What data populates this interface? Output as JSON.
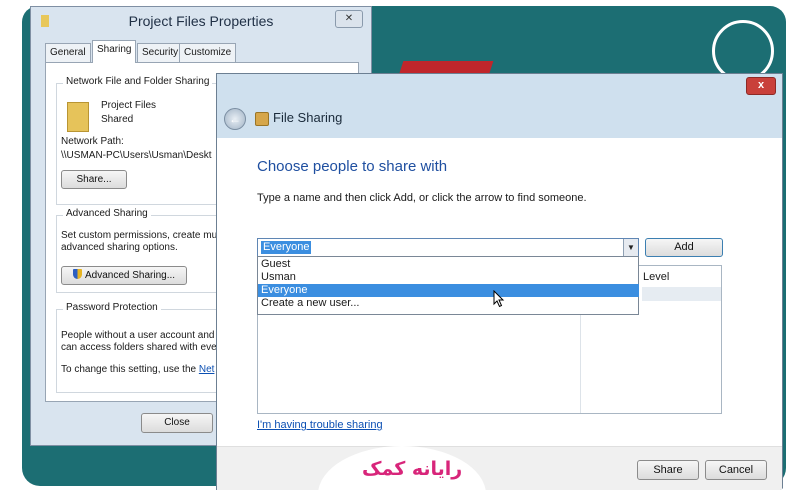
{
  "properties_window": {
    "title": "Project Files Properties",
    "close_glyph": "✕",
    "tabs": [
      "General",
      "Sharing",
      "Security",
      "Customize"
    ],
    "network_sharing": {
      "legend": "Network File and Folder Sharing",
      "folder_name": "Project Files",
      "folder_state": "Shared",
      "network_path_label": "Network Path:",
      "network_path": "\\\\USMAN-PC\\Users\\Usman\\Deskt",
      "share_button": "Share..."
    },
    "advanced_sharing": {
      "legend": "Advanced Sharing",
      "description_line1": "Set custom permissions, create mult",
      "description_line2": "advanced sharing options.",
      "button": "Advanced Sharing..."
    },
    "password_protection": {
      "legend": "Password Protection",
      "line1": "People without a user account and",
      "line2": "can access folders shared with eve",
      "line3_prefix": "To change this setting, use the ",
      "line3_link": "Net"
    },
    "close_button": "Close"
  },
  "file_sharing_dialog": {
    "title": "File Sharing",
    "close_glyph": "x",
    "back_glyph": "←",
    "heading": "Choose people to share with",
    "instruction": "Type a name and then click Add, or click the arrow to find someone.",
    "combo_value": "Everyone",
    "combo_arrow": "▼",
    "add_button": "Add",
    "dropdown_options": [
      "Guest",
      "Usman",
      "Everyone",
      "Create a new user..."
    ],
    "selected_option": "Everyone",
    "list_column_level": "Level",
    "trouble_link": "I'm having trouble sharing",
    "share_button": "Share",
    "cancel_button": "Cancel"
  },
  "watermark": {
    "brand": "رایانه کمک"
  },
  "colors": {
    "desktop": "#1c6e73",
    "selection": "#3b8ee0",
    "heading": "#1f4fa0",
    "link": "#0b4fb3",
    "brand": "#d8257a"
  }
}
